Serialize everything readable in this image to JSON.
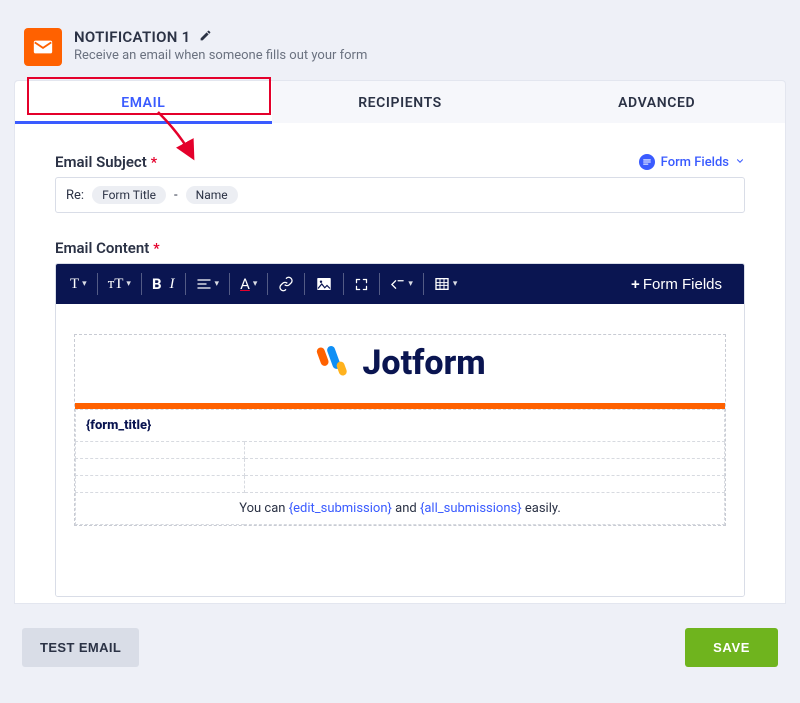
{
  "header": {
    "title": "NOTIFICATION 1",
    "subtitle": "Receive an email when someone fills out your form"
  },
  "tabs": {
    "items": [
      "EMAIL",
      "RECIPIENTS",
      "ADVANCED"
    ],
    "active_index": 0
  },
  "subject": {
    "label": "Email Subject",
    "prefix": "Re:",
    "chips": [
      "Form Title",
      "Name"
    ],
    "separator": "-",
    "form_fields_link": "Form Fields"
  },
  "content": {
    "label": "Email Content",
    "toolbar_form_fields": "Form Fields",
    "brand": "Jotform",
    "form_title_token": "{form_title}",
    "footer_pre": "You can ",
    "footer_link1": "{edit_submission}",
    "footer_mid": " and ",
    "footer_link2": "{all_submissions}",
    "footer_post": " easily."
  },
  "footer": {
    "test": "TEST EMAIL",
    "save": "SAVE"
  }
}
